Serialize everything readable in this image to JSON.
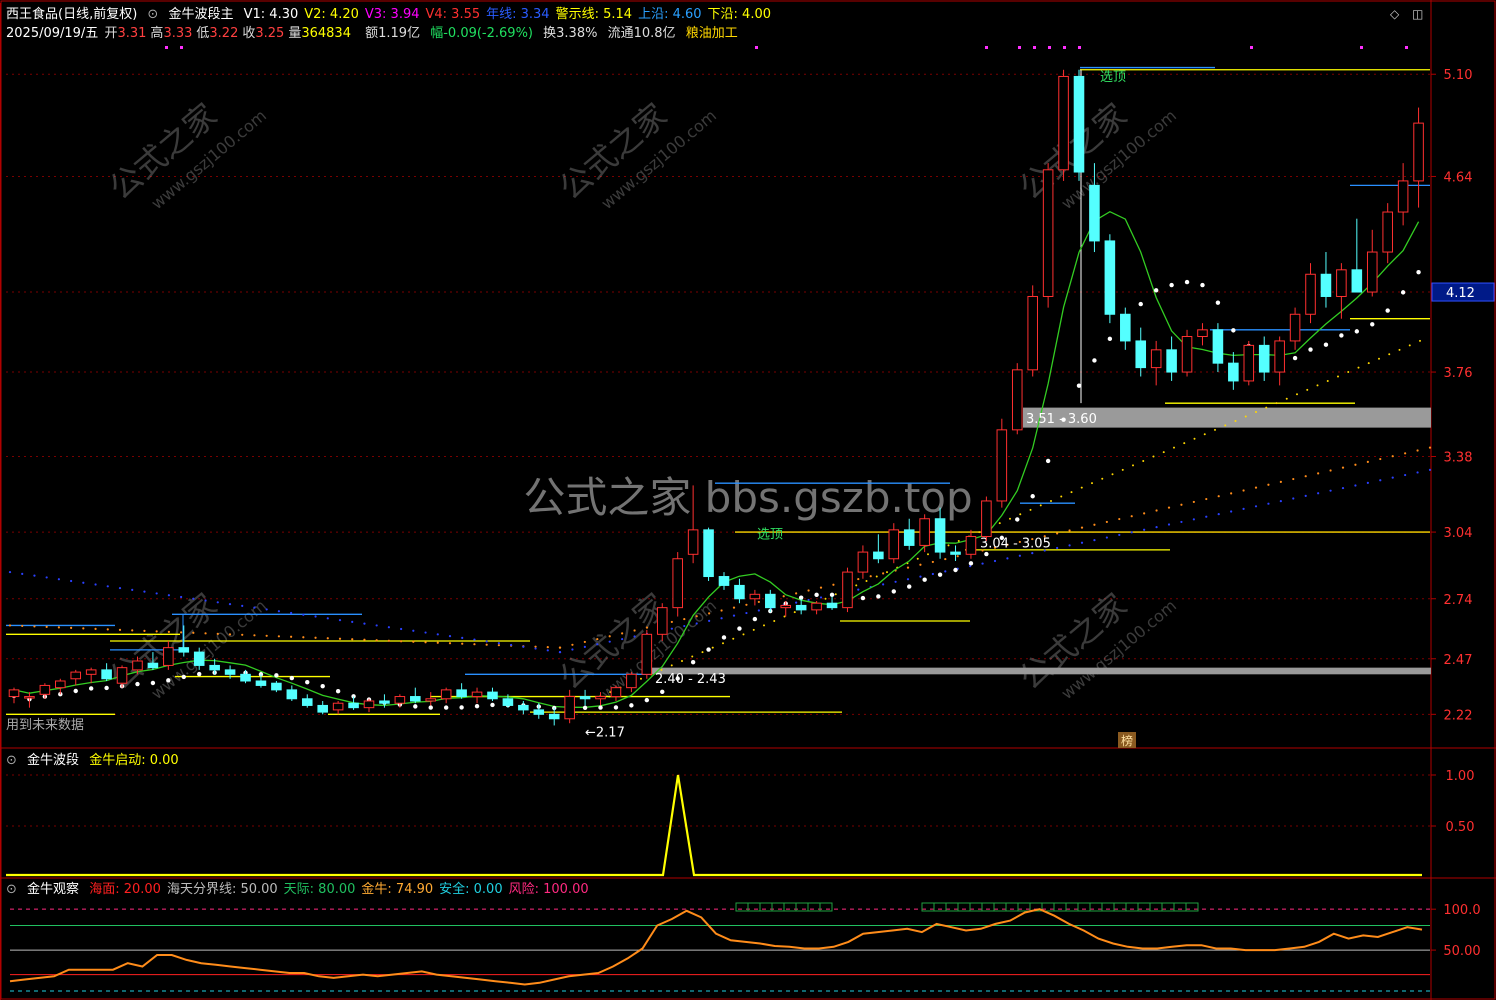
{
  "header": {
    "stock_title": "西王食品(日线,前复权)",
    "indicator_name": "金牛波段主",
    "indicator_values": [
      {
        "label": "V1: 4.30",
        "color": "#ffffff"
      },
      {
        "label": "V2: 4.20",
        "color": "#ffff00"
      },
      {
        "label": "V3: 3.94",
        "color": "#ff00ff"
      },
      {
        "label": "V4: 3.55",
        "color": "#ff3030"
      },
      {
        "label": "年线: 3.34",
        "color": "#2a5cff"
      },
      {
        "label": "警示线: 5.14",
        "color": "#ffff00"
      },
      {
        "label": "上沿: 4.60",
        "color": "#2aa0ff"
      },
      {
        "label": "下沿: 4.00",
        "color": "#ffff00"
      }
    ],
    "date": "2025/09/19/五",
    "quote": [
      {
        "label": "开",
        "value": "3.31"
      },
      {
        "label": "高",
        "value": "3.33"
      },
      {
        "label": "低",
        "value": "3.22"
      },
      {
        "label": "收",
        "value": "3.25"
      },
      {
        "label": "量",
        "value": "364834"
      }
    ],
    "amount": "额1.19亿",
    "change": "幅-0.09(-2.69%)",
    "turnover": "换3.38%",
    "float_cap": "流通10.8亿",
    "sector": "粮油加工"
  },
  "main_panel": {
    "future_data_note": "用到未来数据",
    "price_label": "4.12",
    "badge": "榜",
    "annotations": [
      "选顶",
      "选顶",
      "3.51 - 3.60",
      "3.04 - 3.05",
      "2.40 - 2.43",
      "←2.17"
    ],
    "y_ticks": [
      "5.10",
      "4.64",
      "3.76",
      "3.38",
      "3.04",
      "2.74",
      "2.47",
      "2.22"
    ],
    "watermark": "公式之家 bbs.gszb.top",
    "watermark_small": "公式之家",
    "watermark_url": "www.gszj100.com"
  },
  "panel2": {
    "name": "金牛波段",
    "value_label": "金牛启动: 0.00",
    "y_ticks": [
      "1.00",
      "0.50"
    ]
  },
  "panel3": {
    "name": "金牛观察",
    "items": [
      {
        "label": "海面: 20.00",
        "color": "#ff2020"
      },
      {
        "label": "海天分界线: 50.00",
        "color": "#bbbbbb"
      },
      {
        "label": "天际: 80.00",
        "color": "#20c060"
      },
      {
        "label": "金牛: 74.90",
        "color": "#ffaa33"
      },
      {
        "label": "安全: 0.00",
        "color": "#20d0e0"
      },
      {
        "label": "风险: 100.00",
        "color": "#ff2a80"
      }
    ],
    "y_ticks": [
      "100.0",
      "50.00"
    ]
  },
  "colors": {
    "up": "#ff3030",
    "down": "#54ffff",
    "axis": "#b00000",
    "ma": "#2aa000"
  },
  "chart_data": {
    "type": "candlestick",
    "ylim": [
      2.1,
      5.2
    ],
    "series": [
      {
        "name": "K线",
        "ohlc": [
          [
            2.3,
            2.34,
            2.27,
            2.33
          ],
          [
            2.3,
            2.32,
            2.25,
            2.3
          ],
          [
            2.31,
            2.36,
            2.29,
            2.35
          ],
          [
            2.34,
            2.38,
            2.31,
            2.37
          ],
          [
            2.38,
            2.42,
            2.35,
            2.41
          ],
          [
            2.4,
            2.43,
            2.36,
            2.42
          ],
          [
            2.42,
            2.45,
            2.37,
            2.38
          ],
          [
            2.36,
            2.44,
            2.34,
            2.43
          ],
          [
            2.42,
            2.48,
            2.4,
            2.46
          ],
          [
            2.45,
            2.5,
            2.42,
            2.43
          ],
          [
            2.44,
            2.55,
            2.42,
            2.52
          ],
          [
            2.52,
            2.62,
            2.48,
            2.5
          ],
          [
            2.5,
            2.52,
            2.42,
            2.44
          ],
          [
            2.44,
            2.47,
            2.4,
            2.42
          ],
          [
            2.42,
            2.44,
            2.38,
            2.4
          ],
          [
            2.4,
            2.42,
            2.36,
            2.37
          ],
          [
            2.37,
            2.4,
            2.34,
            2.35
          ],
          [
            2.36,
            2.37,
            2.32,
            2.33
          ],
          [
            2.33,
            2.35,
            2.28,
            2.29
          ],
          [
            2.29,
            2.31,
            2.25,
            2.26
          ],
          [
            2.26,
            2.28,
            2.22,
            2.23
          ],
          [
            2.24,
            2.28,
            2.22,
            2.27
          ],
          [
            2.27,
            2.3,
            2.24,
            2.25
          ],
          [
            2.25,
            2.29,
            2.23,
            2.28
          ],
          [
            2.28,
            2.31,
            2.25,
            2.27
          ],
          [
            2.27,
            2.31,
            2.25,
            2.3
          ],
          [
            2.3,
            2.34,
            2.27,
            2.28
          ],
          [
            2.28,
            2.32,
            2.26,
            2.29
          ],
          [
            2.29,
            2.34,
            2.27,
            2.33
          ],
          [
            2.33,
            2.36,
            2.29,
            2.3
          ],
          [
            2.3,
            2.34,
            2.27,
            2.32
          ],
          [
            2.32,
            2.34,
            2.28,
            2.29
          ],
          [
            2.29,
            2.31,
            2.25,
            2.26
          ],
          [
            2.26,
            2.28,
            2.22,
            2.24
          ],
          [
            2.24,
            2.27,
            2.2,
            2.22
          ],
          [
            2.22,
            2.25,
            2.17,
            2.2
          ],
          [
            2.2,
            2.33,
            2.18,
            2.3
          ],
          [
            2.3,
            2.33,
            2.26,
            2.29
          ],
          [
            2.29,
            2.32,
            2.26,
            2.3
          ],
          [
            2.3,
            2.35,
            2.28,
            2.34
          ],
          [
            2.34,
            2.41,
            2.32,
            2.4
          ],
          [
            2.4,
            2.6,
            2.38,
            2.58
          ],
          [
            2.58,
            2.72,
            2.55,
            2.7
          ],
          [
            2.7,
            2.95,
            2.66,
            2.92
          ],
          [
            2.94,
            3.25,
            2.9,
            3.05
          ],
          [
            3.05,
            3.06,
            2.82,
            2.84
          ],
          [
            2.84,
            2.86,
            2.78,
            2.8
          ],
          [
            2.8,
            2.83,
            2.72,
            2.74
          ],
          [
            2.74,
            2.78,
            2.71,
            2.76
          ],
          [
            2.76,
            2.78,
            2.68,
            2.7
          ],
          [
            2.7,
            2.73,
            2.66,
            2.71
          ],
          [
            2.71,
            2.74,
            2.67,
            2.69
          ],
          [
            2.69,
            2.73,
            2.67,
            2.72
          ],
          [
            2.72,
            2.75,
            2.69,
            2.7
          ],
          [
            2.7,
            2.88,
            2.68,
            2.86
          ],
          [
            2.86,
            2.98,
            2.83,
            2.95
          ],
          [
            2.95,
            3.03,
            2.9,
            2.92
          ],
          [
            2.92,
            3.08,
            2.9,
            3.05
          ],
          [
            3.05,
            3.1,
            2.96,
            2.98
          ],
          [
            2.98,
            3.12,
            2.95,
            3.1
          ],
          [
            3.1,
            3.15,
            2.92,
            2.95
          ],
          [
            2.95,
            2.98,
            2.91,
            2.94
          ],
          [
            2.94,
            3.05,
            2.92,
            3.02
          ],
          [
            3.02,
            3.2,
            3.0,
            3.18
          ],
          [
            3.18,
            3.55,
            3.15,
            3.5
          ],
          [
            3.5,
            3.8,
            3.48,
            3.77
          ],
          [
            3.77,
            4.15,
            3.74,
            4.1
          ],
          [
            4.1,
            4.7,
            4.05,
            4.67
          ],
          [
            4.67,
            5.12,
            4.62,
            5.09
          ],
          [
            5.09,
            5.12,
            4.62,
            4.66
          ],
          [
            4.6,
            4.7,
            4.3,
            4.35
          ],
          [
            4.35,
            4.38,
            3.98,
            4.02
          ],
          [
            4.02,
            4.05,
            3.86,
            3.9
          ],
          [
            3.9,
            3.96,
            3.74,
            3.78
          ],
          [
            3.78,
            3.9,
            3.7,
            3.86
          ],
          [
            3.86,
            3.92,
            3.72,
            3.76
          ],
          [
            3.76,
            3.95,
            3.74,
            3.92
          ],
          [
            3.92,
            3.98,
            3.88,
            3.95
          ],
          [
            3.95,
            3.98,
            3.76,
            3.8
          ],
          [
            3.8,
            3.85,
            3.68,
            3.72
          ],
          [
            3.72,
            3.9,
            3.7,
            3.88
          ],
          [
            3.88,
            3.92,
            3.72,
            3.76
          ],
          [
            3.76,
            3.92,
            3.7,
            3.9
          ],
          [
            3.9,
            4.05,
            3.86,
            4.02
          ],
          [
            4.02,
            4.25,
            3.98,
            4.2
          ],
          [
            4.2,
            4.3,
            4.05,
            4.1
          ],
          [
            4.1,
            4.25,
            4.0,
            4.22
          ],
          [
            4.22,
            4.45,
            4.18,
            4.12
          ],
          [
            4.12,
            4.4,
            4.1,
            4.3
          ],
          [
            4.3,
            4.52,
            4.25,
            4.48
          ],
          [
            4.48,
            4.7,
            4.42,
            4.62
          ],
          [
            4.62,
            4.95,
            4.5,
            4.88
          ]
        ]
      }
    ]
  }
}
